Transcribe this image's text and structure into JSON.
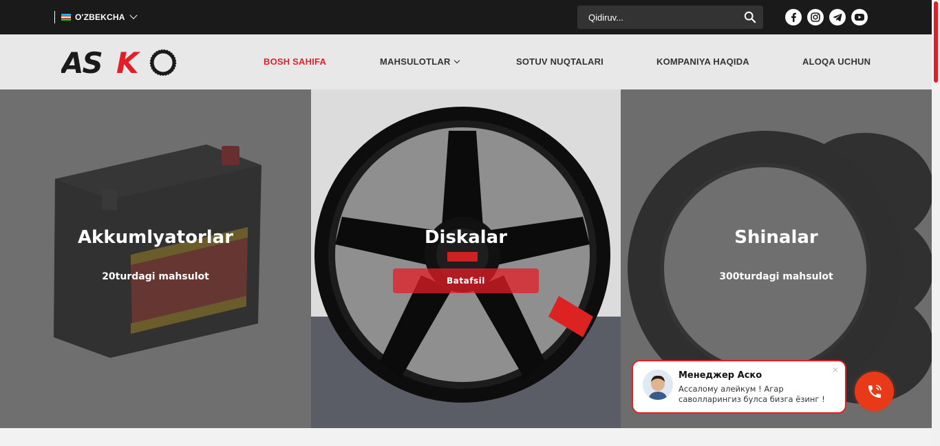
{
  "topbar": {
    "language": "O'ZBEKCHA",
    "search_placeholder": "Qidiruv...",
    "social": [
      "facebook-icon",
      "instagram-icon",
      "telegram-icon",
      "youtube-icon"
    ]
  },
  "header": {
    "logo_text": "ASKO",
    "nav": [
      {
        "label": "BOSH SAHIFA",
        "active": true
      },
      {
        "label": "MAHSULOTLAR",
        "active": false,
        "dropdown": true
      },
      {
        "label": "SOTUV NUQTALARI",
        "active": false
      },
      {
        "label": "KOMPANIYA HAQIDA",
        "active": false
      },
      {
        "label": "ALOQA UCHUN",
        "active": false
      }
    ]
  },
  "categories": [
    {
      "title": "Akkumlyatorlar",
      "count": "20turdagi mahsulot"
    },
    {
      "title": "Diskalar",
      "button": "Batafsil"
    },
    {
      "title": "Shinalar",
      "count": "300turdagi mahsulot"
    }
  ],
  "chat": {
    "name": "Менеджер Аско",
    "message": "Ассалому алейкум ! Агар саволларингиз булса бизга ёзинг !",
    "close": "×"
  },
  "colors": {
    "accent": "#e41e26",
    "topbar": "#1a1a1a",
    "header": "#e8e8e8",
    "call_button": "#e83a18"
  }
}
